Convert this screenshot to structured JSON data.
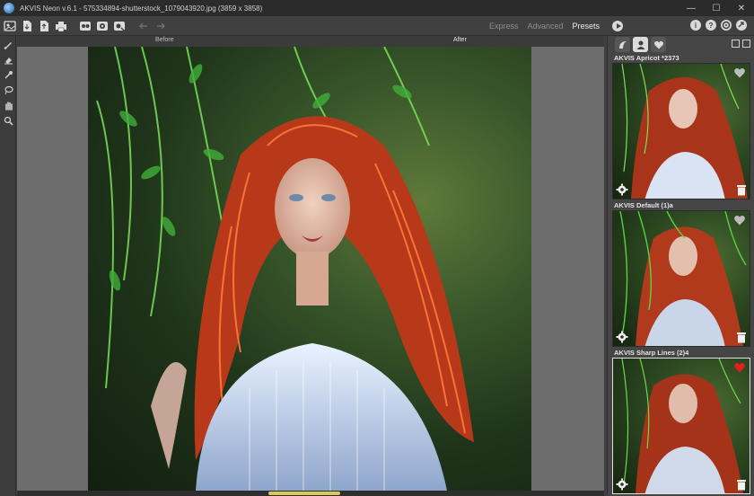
{
  "window": {
    "title": "AKVIS Neon v.6.1 - 575334894-shutterstock_1079043920.jpg (3859 x 3858)",
    "controls": [
      "—",
      "☐",
      "✕"
    ]
  },
  "toolbar": {
    "buttons": [
      "open-icon",
      "save-icon",
      "export-icon",
      "print-icon",
      "batch-icon",
      "load-settings-icon",
      "save-settings-icon",
      "undo-icon",
      "redo-icon"
    ],
    "modes": [
      "Express",
      "Advanced",
      "Presets"
    ],
    "active_mode": "Presets",
    "help_icons": [
      "i",
      "?"
    ]
  },
  "tools": [
    "brush-icon",
    "eraser-icon",
    "dropper-icon",
    "lasso-icon",
    "hand-icon",
    "zoom-icon"
  ],
  "canvas": {
    "tab_before": "Before",
    "tab_after": "After"
  },
  "panel": {
    "presets": [
      {
        "title": "AKVIS Apricot *2373",
        "favorite": false
      },
      {
        "title": "AKVIS Default (1)a",
        "favorite": false
      },
      {
        "title": "AKVIS Sharp Lines (2)4",
        "favorite": true
      }
    ],
    "colors": {
      "favorite": "#e02020",
      "heart_off": "#bdbdbd"
    }
  }
}
